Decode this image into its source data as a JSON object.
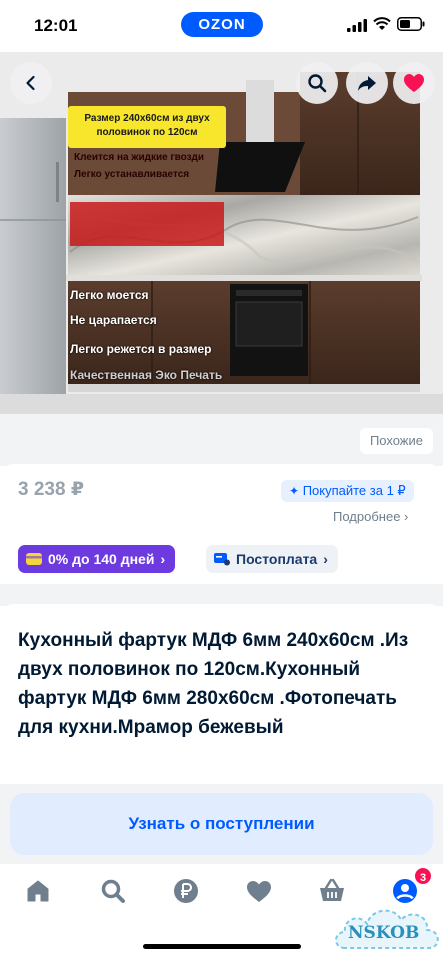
{
  "status_bar": {
    "time": "12:01",
    "brand": "OZON"
  },
  "gallery": {
    "promo_size": "Размер 240x60см из двух половинок по 120см",
    "promo_glue": "Клеится на жидкие гвозди",
    "promo_install": "Легко устанавливается",
    "features": [
      "Легко моется",
      "Не царапается",
      "Легко режется в размер",
      "Качественная Эко Печать"
    ]
  },
  "similar_label": "Похожие",
  "price": "3 238 ₽",
  "buy_for_label": "Покупайте за 1 ₽",
  "more_label": "Подробнее ›",
  "credit_label": "0% до 140 дней",
  "postpay_label": "Постоплата",
  "product_title": "Кухонный фартук МДФ 6мм 240x60см .Из двух половинок по 120см.Кухонный фартук МДФ 6мм 280x60см .Фотопечать для кухни.Мрамор бежевый",
  "notify_button": "Узнать о поступлении",
  "bottom_nav": {
    "items": [
      "home-icon",
      "search-icon",
      "ruble-icon",
      "heart-icon",
      "basket-icon",
      "profile-icon"
    ],
    "profile_badge": "3"
  },
  "watermark": "NSKOB",
  "colors": {
    "accent": "#005bff",
    "credit": "#6d3ae0",
    "favorite": "#f91155"
  }
}
